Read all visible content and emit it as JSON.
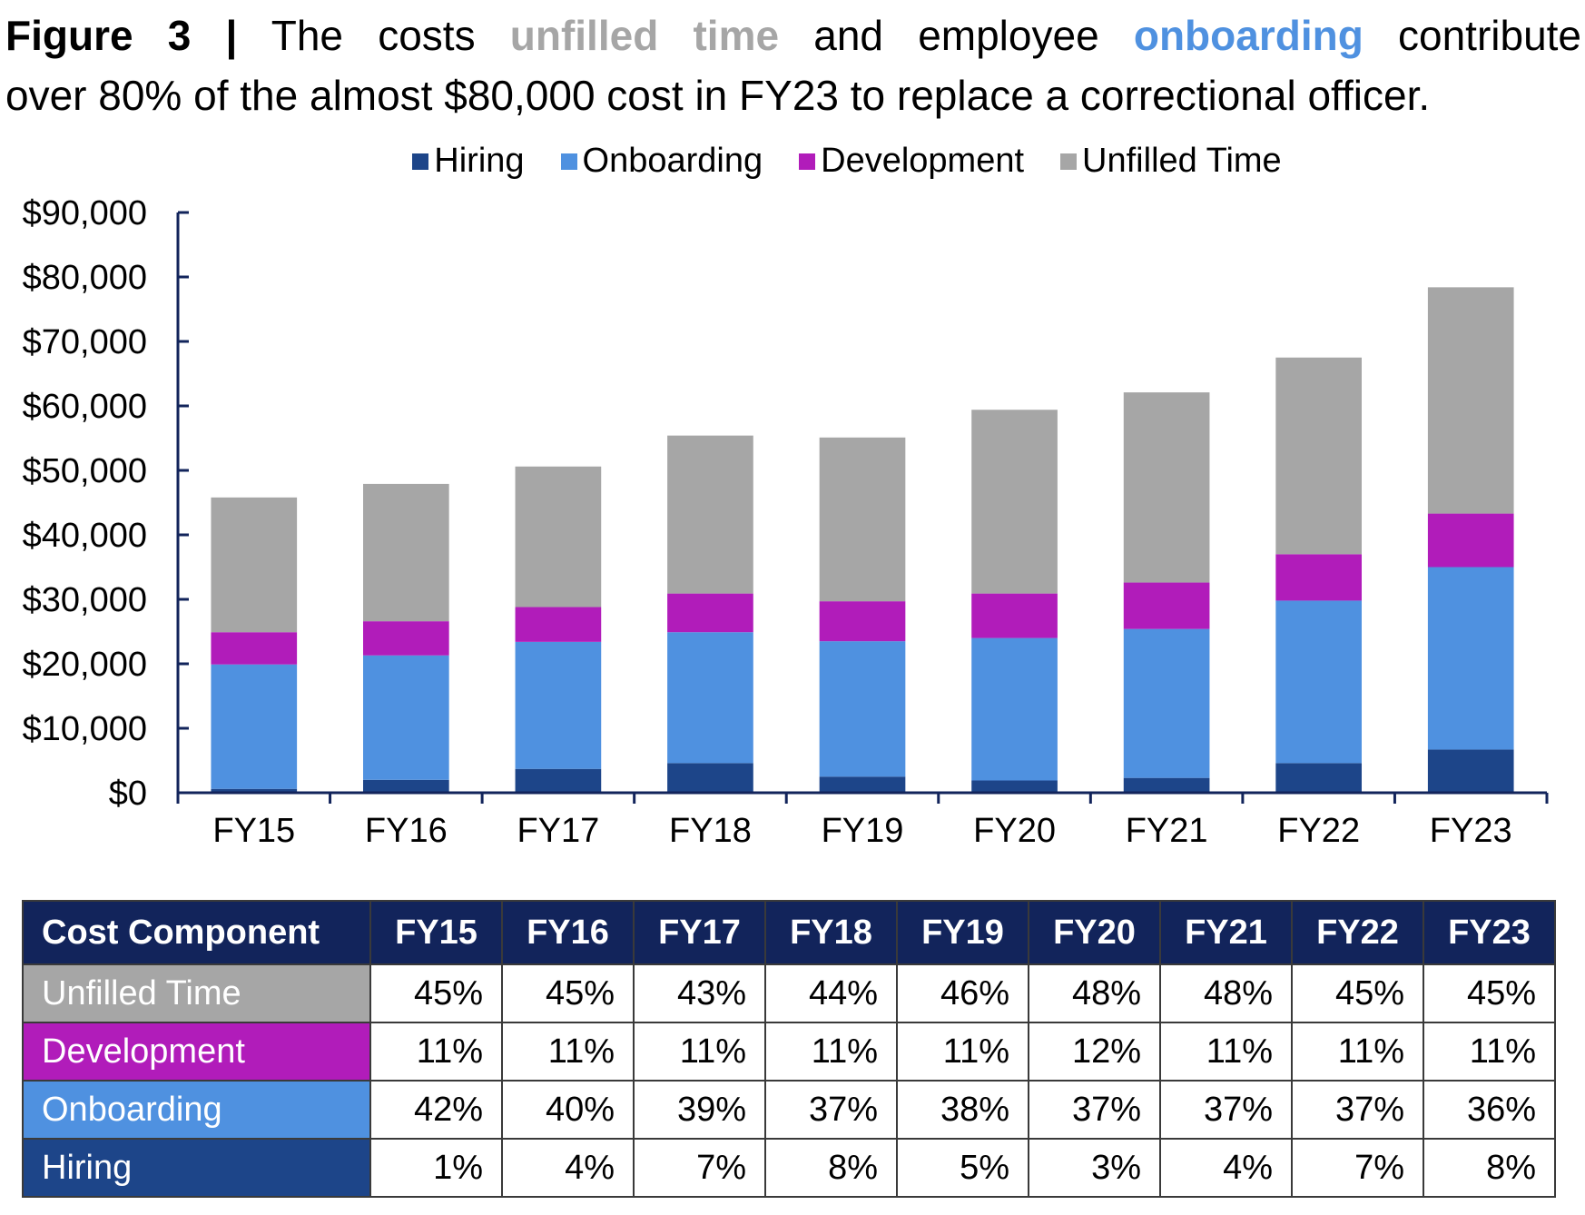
{
  "figure": {
    "label": "Figure 3 |",
    "title_parts": [
      "The costs",
      "unfilled time",
      "and employee",
      "onboarding",
      "contribute"
    ],
    "title_line2": "over 80% of the almost $80,000 cost in FY23 to replace a correctional officer."
  },
  "colors": {
    "hiring": "#1d4589",
    "onboarding": "#4f91e0",
    "development": "#b11cba",
    "unfilled": "#a6a6a6",
    "axis": "#12245b",
    "header": "#12245b"
  },
  "chart_data": {
    "type": "bar",
    "stacked": true,
    "title": "",
    "xlabel": "",
    "ylabel": "",
    "categories": [
      "FY15",
      "FY16",
      "FY17",
      "FY18",
      "FY19",
      "FY20",
      "FY21",
      "FY22",
      "FY23"
    ],
    "series": [
      {
        "name": "Hiring",
        "color": "#1d4589",
        "values": [
          600,
          2000,
          3700,
          4600,
          2500,
          1900,
          2300,
          4600,
          6700
        ]
      },
      {
        "name": "Onboarding",
        "color": "#4f91e0",
        "values": [
          19300,
          19300,
          19700,
          20300,
          21000,
          22100,
          23100,
          25200,
          28300
        ]
      },
      {
        "name": "Development",
        "color": "#b11cba",
        "values": [
          5000,
          5300,
          5400,
          6000,
          6200,
          6900,
          7200,
          7200,
          8300
        ]
      },
      {
        "name": "Unfilled Time",
        "color": "#a6a6a6",
        "values": [
          20900,
          21300,
          21800,
          24500,
          25400,
          28500,
          29500,
          30500,
          35100
        ]
      }
    ],
    "ylim": [
      0,
      90000
    ],
    "yticks": [
      0,
      10000,
      20000,
      30000,
      40000,
      50000,
      60000,
      70000,
      80000,
      90000
    ],
    "ytick_labels": [
      "$0",
      "$10,000",
      "$20,000",
      "$30,000",
      "$40,000",
      "$50,000",
      "$60,000",
      "$70,000",
      "$80,000",
      "$90,000"
    ],
    "grid": false,
    "legend": [
      "Hiring",
      "Onboarding",
      "Development",
      "Unfilled Time"
    ],
    "legend_position": "top"
  },
  "table": {
    "header": [
      "Cost Component",
      "FY15",
      "FY16",
      "FY17",
      "FY18",
      "FY19",
      "FY20",
      "FY21",
      "FY22",
      "FY23"
    ],
    "rows": [
      {
        "label": "Unfilled Time",
        "color": "#a6a6a6",
        "values": [
          "45%",
          "45%",
          "43%",
          "44%",
          "46%",
          "48%",
          "48%",
          "45%",
          "45%"
        ]
      },
      {
        "label": "Development",
        "color": "#b11cba",
        "values": [
          "11%",
          "11%",
          "11%",
          "11%",
          "11%",
          "12%",
          "11%",
          "11%",
          "11%"
        ]
      },
      {
        "label": "Onboarding",
        "color": "#4f91e0",
        "values": [
          "42%",
          "40%",
          "39%",
          "37%",
          "38%",
          "37%",
          "37%",
          "37%",
          "36%"
        ]
      },
      {
        "label": "Hiring",
        "color": "#1d4589",
        "values": [
          "1%",
          "4%",
          "7%",
          "8%",
          "5%",
          "3%",
          "4%",
          "7%",
          "8%"
        ]
      }
    ]
  }
}
